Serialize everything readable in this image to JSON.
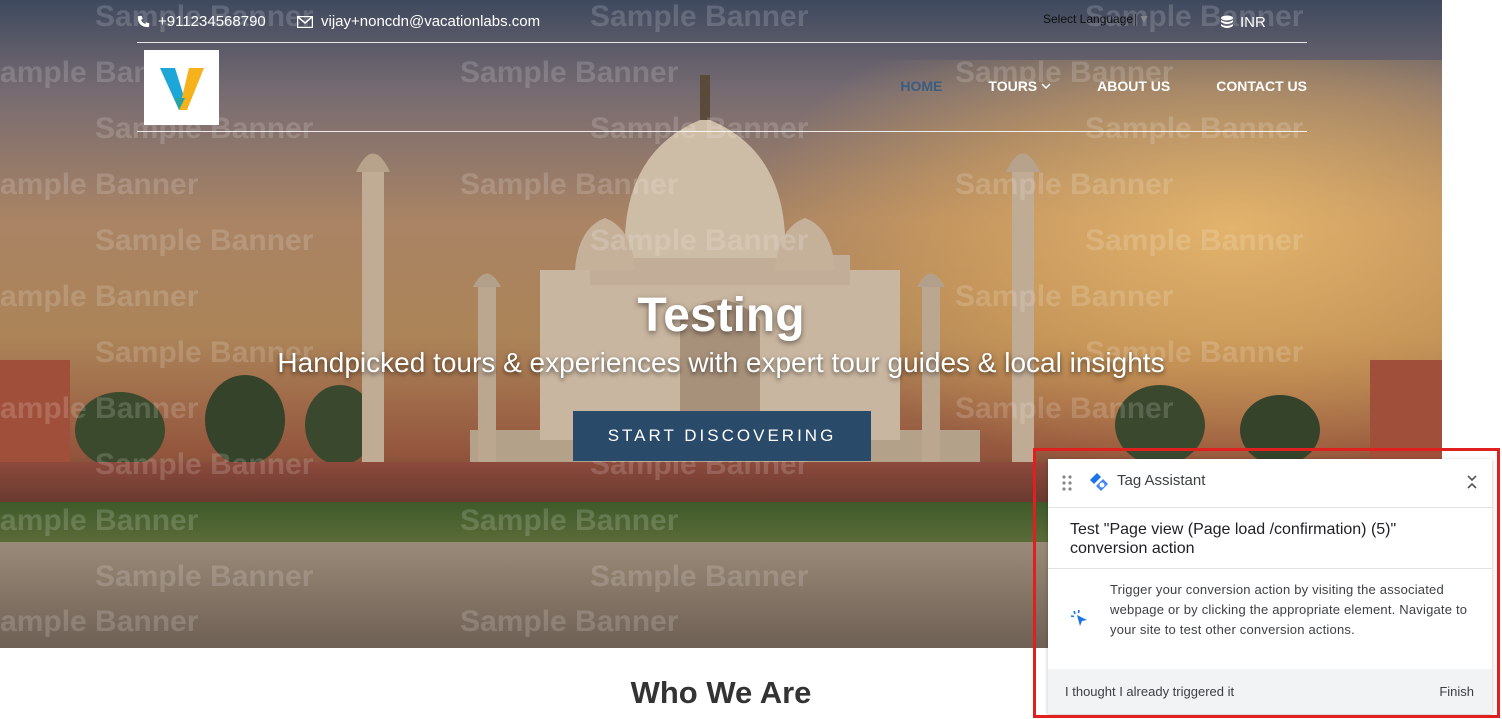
{
  "header": {
    "phone": "+911234568790",
    "email": "vijay+noncdn@vacationlabs.com",
    "language_select": "Select Language",
    "currency": "INR"
  },
  "nav": {
    "items": [
      {
        "label": "HOME",
        "active": true
      },
      {
        "label": "TOURS",
        "active": false,
        "has_dropdown": true
      },
      {
        "label": "ABOUT US",
        "active": false
      },
      {
        "label": "CONTACT US",
        "active": false
      }
    ]
  },
  "hero": {
    "watermark": "Sample Banner",
    "title": "Testing",
    "subtitle": "Handpicked tours & experiences with expert tour guides & local insights",
    "cta_label": "START DISCOVERING"
  },
  "section": {
    "who_we_are": "Who We Are"
  },
  "tag_assistant": {
    "title": "Tag Assistant",
    "test_title": "Test \"Page view (Page load /confirmation) (5)\" conversion action",
    "message": "Trigger your conversion action by visiting the associated webpage or by clicking the appropriate element. Navigate to your site to test other conversion actions.",
    "already_triggered": "I thought I already triggered it",
    "finish": "Finish"
  },
  "colors": {
    "cta_bg": "#2a4a6a",
    "active_nav": "#3b5c82",
    "highlight_border": "#e0201e",
    "tag_blue": "#1a73e8"
  }
}
